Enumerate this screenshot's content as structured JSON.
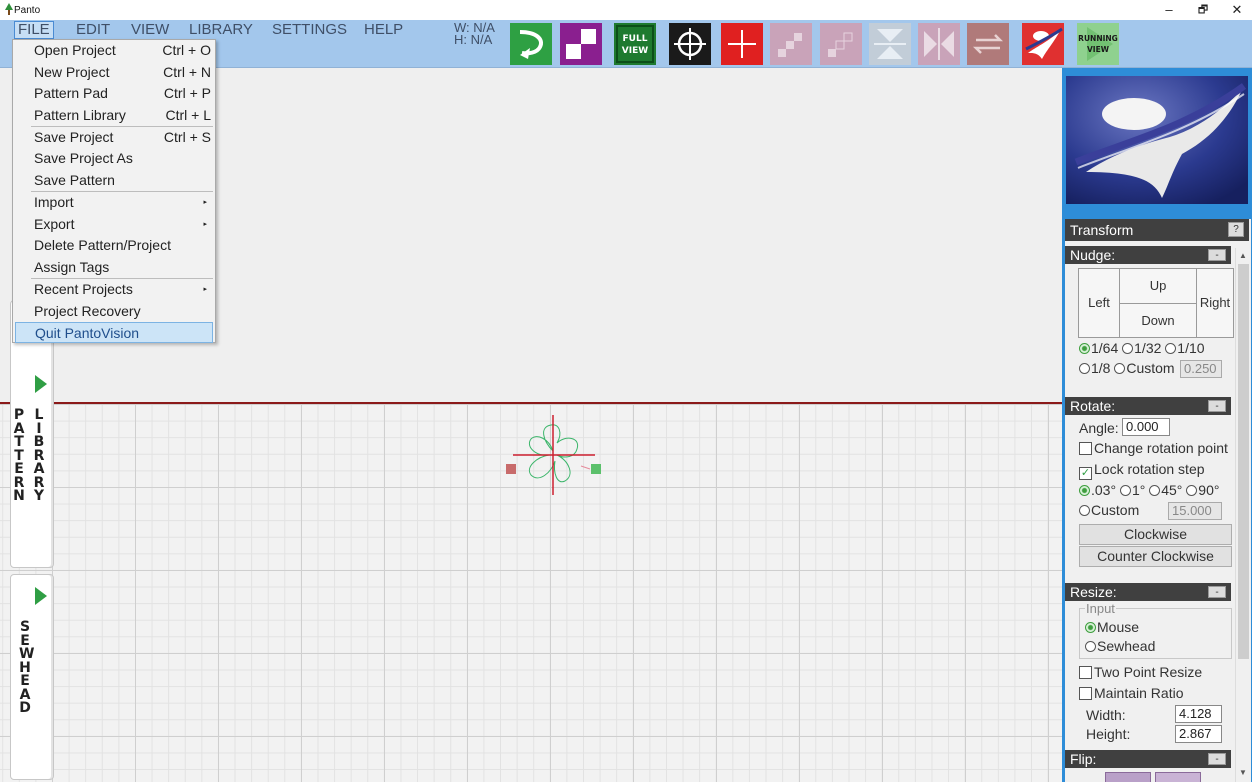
{
  "window": {
    "title": "Panto",
    "controls": {
      "minimize": "–",
      "maximize": "🗗",
      "close": "✕"
    }
  },
  "menubar": {
    "items": [
      "FILE",
      "EDIT",
      "VIEW",
      "LIBRARY",
      "SETTINGS",
      "HELP"
    ],
    "active": "FILE"
  },
  "dimensions": {
    "width": "W: N/A",
    "height": "H: N/A"
  },
  "toolbar": {
    "buttons": [
      {
        "name": "undo-arrow-icon",
        "color": "#2ea043"
      },
      {
        "name": "checker-pattern-icon",
        "color": "#8a1f8f"
      },
      {
        "name": "full-view-button",
        "label1": "FULL",
        "label2": "VIEW",
        "color": "#1e7a2f"
      },
      {
        "name": "crosshair-target-icon",
        "color": "#1a1a1a"
      },
      {
        "name": "red-crosshair-icon",
        "color": "#e02020"
      },
      {
        "name": "steps-icon",
        "color": "#c9a3b9"
      },
      {
        "name": "grid-steps-icon",
        "color": "#c9a3b9"
      },
      {
        "name": "vertical-mirror-icon",
        "color": "#c2cdd8"
      },
      {
        "name": "horizontal-mirror-icon",
        "color": "#c9a3b9"
      },
      {
        "name": "swap-arrows-icon",
        "color": "#b07a7a"
      },
      {
        "name": "panto-logo-icon",
        "color": "#e03030"
      },
      {
        "name": "running-view-button",
        "label1": "RUNNING",
        "label2": "VIEW",
        "color": "#8fd18f"
      }
    ]
  },
  "file_menu": {
    "items": [
      {
        "label": "Open Project",
        "shortcut": "Ctrl + O"
      },
      {
        "label": "New Project",
        "shortcut": "Ctrl + N"
      },
      {
        "label": "Pattern Pad",
        "shortcut": "Ctrl + P"
      },
      {
        "label": "Pattern Library",
        "shortcut": "Ctrl + L"
      },
      {
        "label": "Save Project",
        "shortcut": "Ctrl + S"
      },
      {
        "label": "Save Project As",
        "shortcut": ""
      },
      {
        "label": "Save Pattern",
        "shortcut": ""
      },
      {
        "label": "Import",
        "shortcut": "",
        "submenu": "▸"
      },
      {
        "label": "Export",
        "shortcut": "",
        "submenu": "▸"
      },
      {
        "label": "Delete Pattern/Project",
        "shortcut": ""
      },
      {
        "label": "Assign Tags",
        "shortcut": ""
      },
      {
        "label": "Recent Projects",
        "shortcut": "",
        "submenu": "▸"
      },
      {
        "label": "Project Recovery",
        "shortcut": ""
      },
      {
        "label": "Quit PantoVision",
        "shortcut": "",
        "highlighted": true
      }
    ]
  },
  "side_tabs": {
    "pattern_library": {
      "col1": "PATTERN",
      "col2": "LIBRARY"
    },
    "sewhead": {
      "text": "SEWHEAD"
    }
  },
  "transform_panel": {
    "title": "Transform",
    "help": "?",
    "nudge": {
      "header": "Nudge:",
      "collapse": "-",
      "up": "Up",
      "down": "Down",
      "left": "Left",
      "right": "Right",
      "steps": [
        "1/64",
        "1/32",
        "1/10",
        "1/8"
      ],
      "custom_label": "Custom",
      "custom_value": "0.250",
      "selected": "1/64"
    },
    "rotate": {
      "header": "Rotate:",
      "collapse": "-",
      "angle_label": "Angle:",
      "angle_value": "0.000",
      "change_point_label": "Change rotation point",
      "change_point_checked": false,
      "lock_step_label": "Lock rotation step",
      "lock_step_checked": true,
      "steps": [
        ".03°",
        "1°",
        "45°",
        "90°"
      ],
      "selected": ".03°",
      "custom_label": "Custom",
      "custom_value": "15.000",
      "clockwise": "Clockwise",
      "counter_clockwise": "Counter Clockwise"
    },
    "resize": {
      "header": "Resize:",
      "collapse": "-",
      "input_label": "Input",
      "mouse_label": "Mouse",
      "sewhead_label": "Sewhead",
      "selected": "Mouse",
      "two_point_label": "Two Point Resize",
      "maintain_ratio_label": "Maintain Ratio",
      "width_label": "Width:",
      "width_value": "4.128",
      "height_label": "Height:",
      "height_value": "2.867"
    },
    "flip": {
      "header": "Flip:",
      "collapse": "-"
    }
  },
  "colors": {
    "toolbar_bg": "#a3c7ec",
    "panel_bg": "#2e8dd8",
    "section_header": "#404040",
    "grid_top_line": "#8b1a1a",
    "accent_green": "#2f9e44"
  }
}
